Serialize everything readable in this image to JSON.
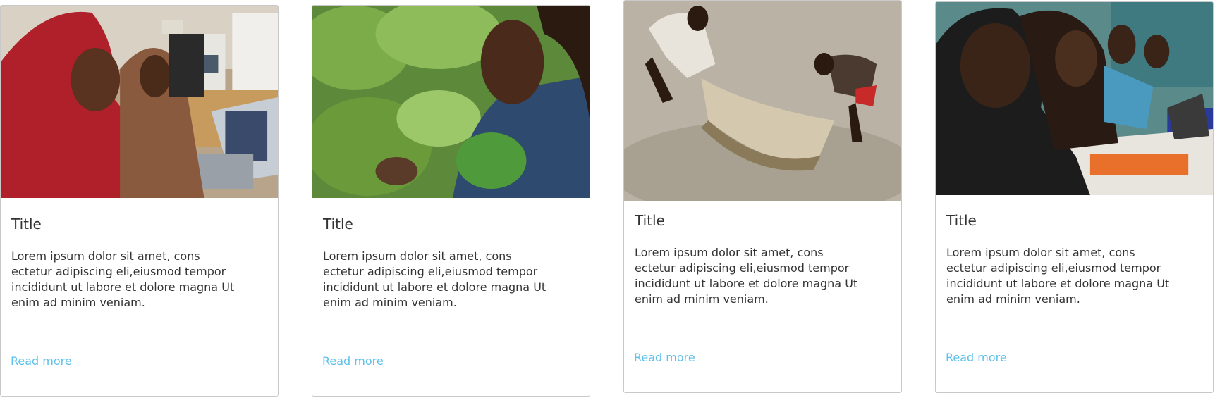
{
  "cards": [
    {
      "image": "women-at-computers-photo",
      "title": "Title",
      "description": "Lorem ipsum dolor sit amet, cons ectetur adipiscing eli,eiusmod tempor incididunt ut labore et dolore magna Ut enim ad minim veniam.",
      "link": "Read more"
    },
    {
      "image": "woman-with-cassava-plant-photo",
      "title": "Title",
      "description": "Lorem ipsum dolor sit amet, cons ectetur adipiscing eli,eiusmod tempor incididunt ut labore et dolore magna Ut enim ad minim veniam.",
      "link": "Read more"
    },
    {
      "image": "men-fishing-with-net-photo",
      "title": "Title",
      "description": "Lorem ipsum dolor sit amet, cons ectetur adipiscing eli,eiusmod tempor incididunt ut labore et dolore magna Ut enim ad minim veniam.",
      "link": "Read more"
    },
    {
      "image": "students-at-laptops-photo",
      "title": "Title",
      "description": "Lorem ipsum dolor sit amet, cons ectetur adipiscing eli,eiusmod tempor incididunt ut labore et dolore magna Ut enim ad minim veniam.",
      "link": "Read more"
    }
  ],
  "colors": {
    "link": "#5bc0eb",
    "text": "#333333",
    "border": "#c9c9c9"
  }
}
